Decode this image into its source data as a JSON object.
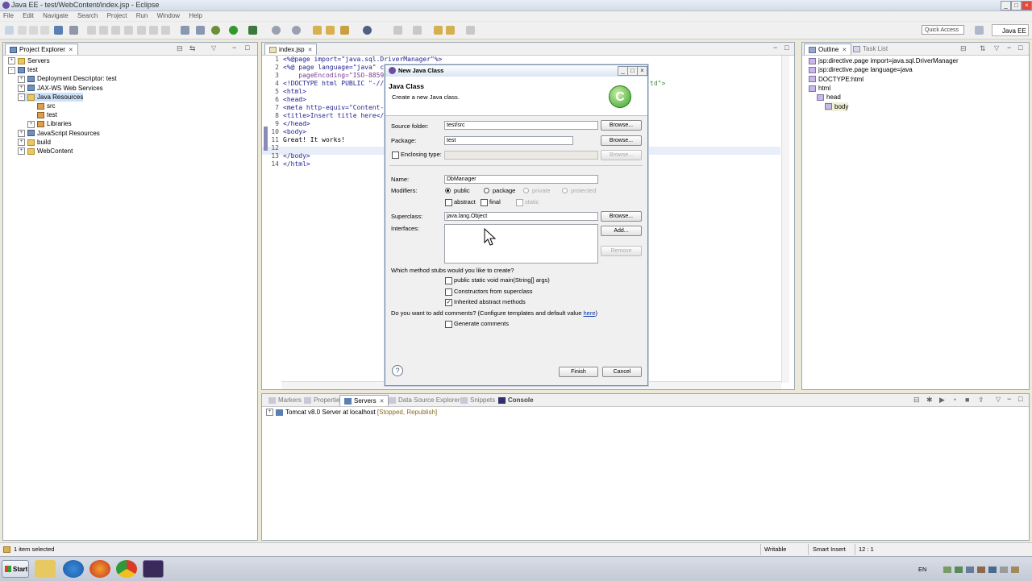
{
  "window": {
    "title": "Java EE - test/WebContent/index.jsp - Eclipse"
  },
  "menu": [
    "File",
    "Edit",
    "Navigate",
    "Search",
    "Project",
    "Run",
    "Window",
    "Help"
  ],
  "toolbar": {
    "quick_access": "Quick Access",
    "perspective": "Java EE"
  },
  "project_explorer": {
    "tab": "Project Explorer",
    "tree": [
      {
        "label": "Servers",
        "level": 0,
        "twisty": "+",
        "icon": "folder"
      },
      {
        "label": "test",
        "level": 0,
        "twisty": "-",
        "icon": "proj"
      },
      {
        "label": "Deployment Descriptor: test",
        "level": 1,
        "twisty": "+",
        "icon": "proj"
      },
      {
        "label": "JAX-WS Web Services",
        "level": 1,
        "twisty": "+",
        "icon": "proj"
      },
      {
        "label": "Java Resources",
        "level": 1,
        "twisty": "-",
        "icon": "folder"
      },
      {
        "label": "src",
        "level": 2,
        "twisty": "",
        "icon": "pkg"
      },
      {
        "label": "test",
        "level": 2,
        "twisty": "",
        "icon": "pkg"
      },
      {
        "label": "Libraries",
        "level": 2,
        "twisty": "+",
        "icon": "pkg"
      },
      {
        "label": "JavaScript Resources",
        "level": 1,
        "twisty": "+",
        "icon": "proj"
      },
      {
        "label": "build",
        "level": 1,
        "twisty": "+",
        "icon": "folder"
      },
      {
        "label": "WebContent",
        "level": 1,
        "twisty": "+",
        "icon": "folder"
      }
    ]
  },
  "editor": {
    "tab": "index.jsp",
    "lines": [
      {
        "n": "1",
        "text": "<%@page import=\"java.sql.DriverManager\"%>"
      },
      {
        "n": "2",
        "text": "<%@ page language=\"java\" co"
      },
      {
        "n": "3",
        "text": "    pageEncoding=\"ISO-8859-"
      },
      {
        "n": "4",
        "text": "<!DOCTYPE html PUBLIC \"-//W"
      },
      {
        "n": "5",
        "text": "<html>"
      },
      {
        "n": "6",
        "text": "<head>"
      },
      {
        "n": "7",
        "text": "<meta http-equiv=\"Content-T"
      },
      {
        "n": "8",
        "text": "<title>Insert title here</t"
      },
      {
        "n": "9",
        "text": "</head>"
      },
      {
        "n": "10",
        "text": "<body>"
      },
      {
        "n": "11",
        "text": "Great! It works!"
      },
      {
        "n": "12",
        "text": ""
      },
      {
        "n": "13",
        "text": "</body>"
      },
      {
        "n": "14",
        "text": "</html>"
      }
    ],
    "line4_tail": "td\">"
  },
  "outline": {
    "tab": "Outline",
    "tab2": "Task List",
    "tree": [
      {
        "label": "jsp:directive.page import=java.sql.DriverManager",
        "level": 0
      },
      {
        "label": "jsp:directive.page language=java",
        "level": 0
      },
      {
        "label": "DOCTYPE:html",
        "level": 0
      },
      {
        "label": "html",
        "level": 0
      },
      {
        "label": "head",
        "level": 1
      },
      {
        "label": "body",
        "level": 2
      }
    ]
  },
  "bottom": {
    "tabs": [
      "Markers",
      "Properties",
      "Servers",
      "Data Source Explorer",
      "Snippets",
      "Console"
    ],
    "server_name": "Tomcat v8.0 Server at localhost",
    "server_status": "[Stopped, Republish]"
  },
  "dialog": {
    "title": "New Java Class",
    "header_title": "Java Class",
    "header_desc": "Create a new Java class.",
    "source_folder_label": "Source folder:",
    "source_folder_value": "test/src",
    "package_label": "Package:",
    "package_value": "test",
    "enclosing_label": "Enclosing type:",
    "browse": "Browse...",
    "name_label": "Name:",
    "name_value": "DbManager",
    "modifiers_label": "Modifiers:",
    "mod_public": "public",
    "mod_package": "package",
    "mod_private": "private",
    "mod_protected": "protected",
    "mod_abstract": "abstract",
    "mod_final": "final",
    "mod_static": "static",
    "superclass_label": "Superclass:",
    "superclass_value": "java.lang.Object",
    "interfaces_label": "Interfaces:",
    "add": "Add...",
    "remove": "Remove",
    "stubs_question": "Which method stubs would you like to create?",
    "stub_main": "public static void main(String[] args)",
    "stub_ctor": "Constructors from superclass",
    "stub_inherited": "Inherited abstract methods",
    "comments_question": "Do you want to add comments? (Configure templates and default value ",
    "comments_link": "here",
    "comments_close": ")",
    "generate_comments": "Generate comments",
    "finish": "Finish",
    "cancel": "Cancel"
  },
  "status": {
    "selection": "1 item selected",
    "writable": "Writable",
    "insert_mode": "Smart Insert",
    "position": "12 : 1"
  },
  "taskbar": {
    "start": "Start",
    "lang": "EN"
  }
}
